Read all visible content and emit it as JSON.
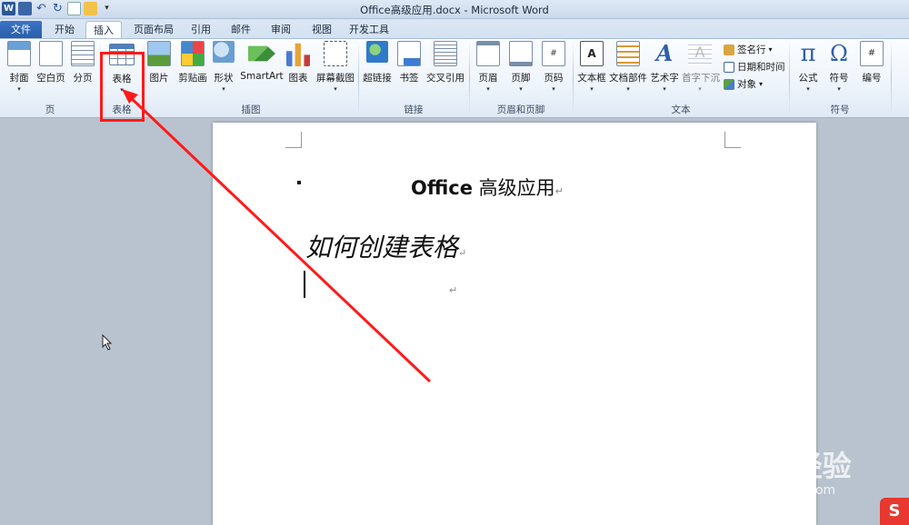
{
  "window": {
    "title": "Office高级应用.docx - Microsoft Word"
  },
  "quick_access": {
    "app_icon": "W"
  },
  "tabs": [
    "文件",
    "开始",
    "插入",
    "页面布局",
    "引用",
    "邮件",
    "审阅",
    "视图",
    "开发工具"
  ],
  "active_tab": "插入",
  "ribbon": {
    "groups": {
      "page": {
        "label": "页",
        "buttons": [
          "封面",
          "空白页",
          "分页"
        ]
      },
      "table": {
        "label": "表格",
        "buttons": [
          "表格"
        ]
      },
      "illustrations": {
        "label": "插图",
        "buttons": [
          "图片",
          "剪贴画",
          "形状",
          "SmartArt",
          "图表",
          "屏幕截图"
        ]
      },
      "links": {
        "label": "链接",
        "buttons": [
          "超链接",
          "书签",
          "交叉引用"
        ]
      },
      "header_footer": {
        "label": "页眉和页脚",
        "buttons": [
          "页眉",
          "页脚",
          "页码"
        ]
      },
      "text": {
        "label": "文本",
        "buttons": [
          "文本框",
          "文档部件",
          "艺术字",
          "首字下沉"
        ],
        "small": [
          "签名行",
          "日期和时间",
          "对象"
        ]
      },
      "symbols": {
        "label": "符号",
        "buttons": [
          "公式",
          "符号",
          "编号"
        ]
      }
    }
  },
  "document": {
    "title_en": "Office",
    "title_cn": "高级应用",
    "heading": "如何创建表格",
    "para_mark": "↵"
  },
  "watermark": {
    "main": "Baidu经验",
    "sub": "jingyan.baidu.com"
  },
  "ime": {
    "label": "S"
  },
  "colors": {
    "annotation": "#ff1a1a",
    "file_tab": "#2b63b5",
    "workspace": "#b9c3cf"
  }
}
